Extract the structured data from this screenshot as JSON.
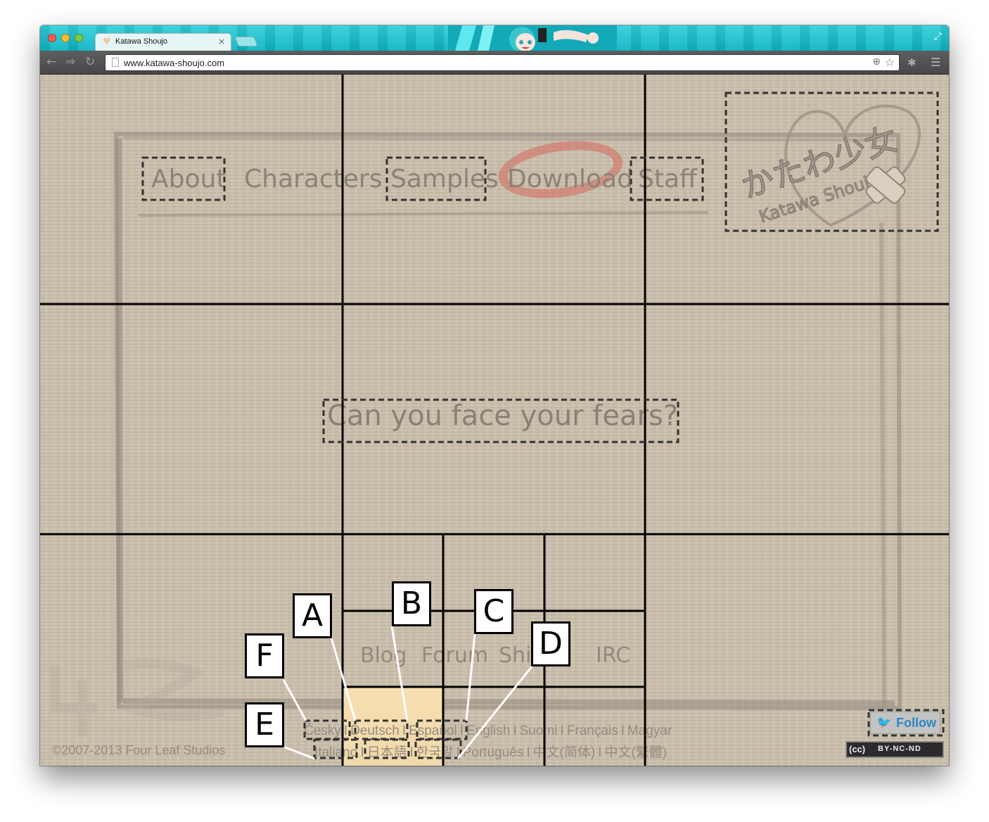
{
  "browser": {
    "tab_title": "Katawa Shoujo",
    "tab_favicon": "heart-icon",
    "url": "www.katawa-shoujo.com",
    "close_tab": "×",
    "back": "←",
    "forward": "⇒",
    "reload": "↻",
    "zoom": "⊕",
    "bookmark": "☆",
    "extensions": "✱",
    "menu": "☰",
    "fullscreen": "⤢"
  },
  "site": {
    "nav": {
      "about": "About",
      "characters": "Characters",
      "samples": "Samples",
      "download": "Download",
      "staff": "Staff"
    },
    "logo_text_jp": "かたわ少女",
    "logo_text_en": "Katawa Shoujo",
    "tagline": "Can you face your fears?",
    "footer_nav": {
      "blog": "Blog",
      "forum": "Forum",
      "shop": "Shi  e",
      "irc": "IRC"
    },
    "languages_row1": [
      "Česky",
      "I",
      "Deutsch",
      "I",
      "Español",
      "I",
      "English",
      "I",
      "Suomi",
      "I",
      "Français",
      "I",
      "Magyar"
    ],
    "languages_row2": [
      "Italiano",
      "I",
      "日本語",
      "I",
      "한국말",
      "I",
      "Português",
      "I",
      "中文(简体)",
      "I",
      "中文(繁體)"
    ],
    "copyright": "©2007-2013 Four Leaf Studios",
    "follow": "Follow",
    "cc_badge": "(cc)",
    "cc_license": "BY-NC-ND",
    "studio_mark": "4LS"
  },
  "annotations": {
    "labels": [
      "A",
      "B",
      "C",
      "D",
      "E",
      "F"
    ]
  },
  "colors": {
    "tabstrip": "#1cc0cd",
    "paper": "#cbbfab",
    "nav_text": "#8b8378",
    "download_ring": "#d4685c",
    "highlight": "#f3dcad",
    "grid": "#000000"
  }
}
